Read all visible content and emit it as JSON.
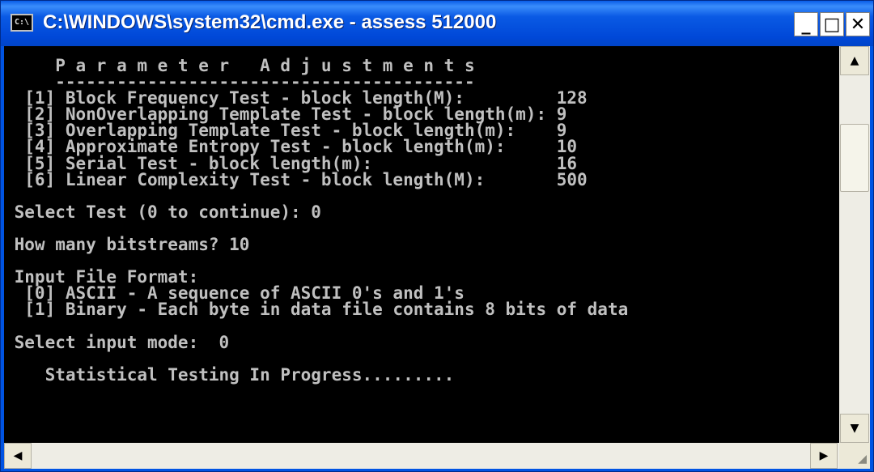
{
  "window": {
    "title": "C:\\WINDOWS\\system32\\cmd.exe - assess 512000",
    "icon_label": "C:\\",
    "controls": {
      "minimize": "_",
      "maximize": "□",
      "close": "✕"
    }
  },
  "console": {
    "lines": [
      "     P a r a m e t e r   A d j u s t m e n t s",
      "     -----------------------------------------",
      "  [1] Block Frequency Test - block length(M):         128",
      "  [2] NonOverlapping Template Test - block length(m): 9",
      "  [3] Overlapping Template Test - block length(m):    9",
      "  [4] Approximate Entropy Test - block length(m):     10",
      "  [5] Serial Test - block length(m):                  16",
      "  [6] Linear Complexity Test - block length(M):       500",
      "",
      " Select Test (0 to continue): 0",
      "",
      " How many bitstreams? 10",
      "",
      " Input File Format:",
      "  [0] ASCII - A sequence of ASCII 0's and 1's",
      "  [1] Binary - Each byte in data file contains 8 bits of data",
      "",
      " Select input mode:  0",
      "",
      "    Statistical Testing In Progress........."
    ]
  },
  "scrollbars": {
    "up": "▲",
    "down": "▼",
    "left": "◀",
    "right": "▶",
    "grip": "◢"
  }
}
